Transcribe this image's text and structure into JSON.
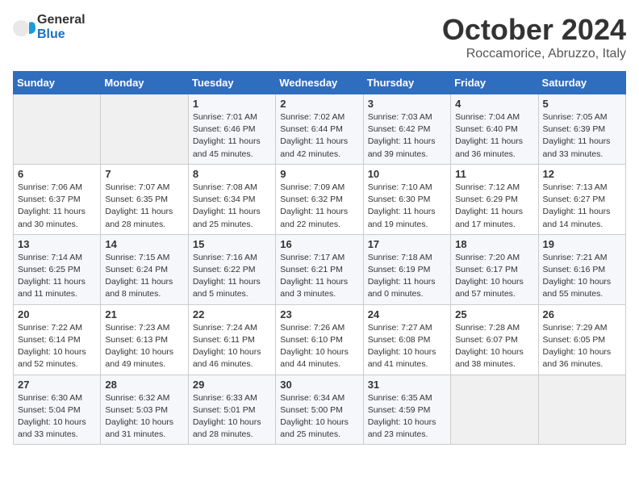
{
  "header": {
    "logo_line1": "General",
    "logo_line2": "Blue",
    "month": "October 2024",
    "location": "Roccamorice, Abruzzo, Italy"
  },
  "weekdays": [
    "Sunday",
    "Monday",
    "Tuesday",
    "Wednesday",
    "Thursday",
    "Friday",
    "Saturday"
  ],
  "weeks": [
    [
      {
        "day": "",
        "info": ""
      },
      {
        "day": "",
        "info": ""
      },
      {
        "day": "1",
        "info": "Sunrise: 7:01 AM\nSunset: 6:46 PM\nDaylight: 11 hours and 45 minutes."
      },
      {
        "day": "2",
        "info": "Sunrise: 7:02 AM\nSunset: 6:44 PM\nDaylight: 11 hours and 42 minutes."
      },
      {
        "day": "3",
        "info": "Sunrise: 7:03 AM\nSunset: 6:42 PM\nDaylight: 11 hours and 39 minutes."
      },
      {
        "day": "4",
        "info": "Sunrise: 7:04 AM\nSunset: 6:40 PM\nDaylight: 11 hours and 36 minutes."
      },
      {
        "day": "5",
        "info": "Sunrise: 7:05 AM\nSunset: 6:39 PM\nDaylight: 11 hours and 33 minutes."
      }
    ],
    [
      {
        "day": "6",
        "info": "Sunrise: 7:06 AM\nSunset: 6:37 PM\nDaylight: 11 hours and 30 minutes."
      },
      {
        "day": "7",
        "info": "Sunrise: 7:07 AM\nSunset: 6:35 PM\nDaylight: 11 hours and 28 minutes."
      },
      {
        "day": "8",
        "info": "Sunrise: 7:08 AM\nSunset: 6:34 PM\nDaylight: 11 hours and 25 minutes."
      },
      {
        "day": "9",
        "info": "Sunrise: 7:09 AM\nSunset: 6:32 PM\nDaylight: 11 hours and 22 minutes."
      },
      {
        "day": "10",
        "info": "Sunrise: 7:10 AM\nSunset: 6:30 PM\nDaylight: 11 hours and 19 minutes."
      },
      {
        "day": "11",
        "info": "Sunrise: 7:12 AM\nSunset: 6:29 PM\nDaylight: 11 hours and 17 minutes."
      },
      {
        "day": "12",
        "info": "Sunrise: 7:13 AM\nSunset: 6:27 PM\nDaylight: 11 hours and 14 minutes."
      }
    ],
    [
      {
        "day": "13",
        "info": "Sunrise: 7:14 AM\nSunset: 6:25 PM\nDaylight: 11 hours and 11 minutes."
      },
      {
        "day": "14",
        "info": "Sunrise: 7:15 AM\nSunset: 6:24 PM\nDaylight: 11 hours and 8 minutes."
      },
      {
        "day": "15",
        "info": "Sunrise: 7:16 AM\nSunset: 6:22 PM\nDaylight: 11 hours and 5 minutes."
      },
      {
        "day": "16",
        "info": "Sunrise: 7:17 AM\nSunset: 6:21 PM\nDaylight: 11 hours and 3 minutes."
      },
      {
        "day": "17",
        "info": "Sunrise: 7:18 AM\nSunset: 6:19 PM\nDaylight: 11 hours and 0 minutes."
      },
      {
        "day": "18",
        "info": "Sunrise: 7:20 AM\nSunset: 6:17 PM\nDaylight: 10 hours and 57 minutes."
      },
      {
        "day": "19",
        "info": "Sunrise: 7:21 AM\nSunset: 6:16 PM\nDaylight: 10 hours and 55 minutes."
      }
    ],
    [
      {
        "day": "20",
        "info": "Sunrise: 7:22 AM\nSunset: 6:14 PM\nDaylight: 10 hours and 52 minutes."
      },
      {
        "day": "21",
        "info": "Sunrise: 7:23 AM\nSunset: 6:13 PM\nDaylight: 10 hours and 49 minutes."
      },
      {
        "day": "22",
        "info": "Sunrise: 7:24 AM\nSunset: 6:11 PM\nDaylight: 10 hours and 46 minutes."
      },
      {
        "day": "23",
        "info": "Sunrise: 7:26 AM\nSunset: 6:10 PM\nDaylight: 10 hours and 44 minutes."
      },
      {
        "day": "24",
        "info": "Sunrise: 7:27 AM\nSunset: 6:08 PM\nDaylight: 10 hours and 41 minutes."
      },
      {
        "day": "25",
        "info": "Sunrise: 7:28 AM\nSunset: 6:07 PM\nDaylight: 10 hours and 38 minutes."
      },
      {
        "day": "26",
        "info": "Sunrise: 7:29 AM\nSunset: 6:05 PM\nDaylight: 10 hours and 36 minutes."
      }
    ],
    [
      {
        "day": "27",
        "info": "Sunrise: 6:30 AM\nSunset: 5:04 PM\nDaylight: 10 hours and 33 minutes."
      },
      {
        "day": "28",
        "info": "Sunrise: 6:32 AM\nSunset: 5:03 PM\nDaylight: 10 hours and 31 minutes."
      },
      {
        "day": "29",
        "info": "Sunrise: 6:33 AM\nSunset: 5:01 PM\nDaylight: 10 hours and 28 minutes."
      },
      {
        "day": "30",
        "info": "Sunrise: 6:34 AM\nSunset: 5:00 PM\nDaylight: 10 hours and 25 minutes."
      },
      {
        "day": "31",
        "info": "Sunrise: 6:35 AM\nSunset: 4:59 PM\nDaylight: 10 hours and 23 minutes."
      },
      {
        "day": "",
        "info": ""
      },
      {
        "day": "",
        "info": ""
      }
    ]
  ]
}
